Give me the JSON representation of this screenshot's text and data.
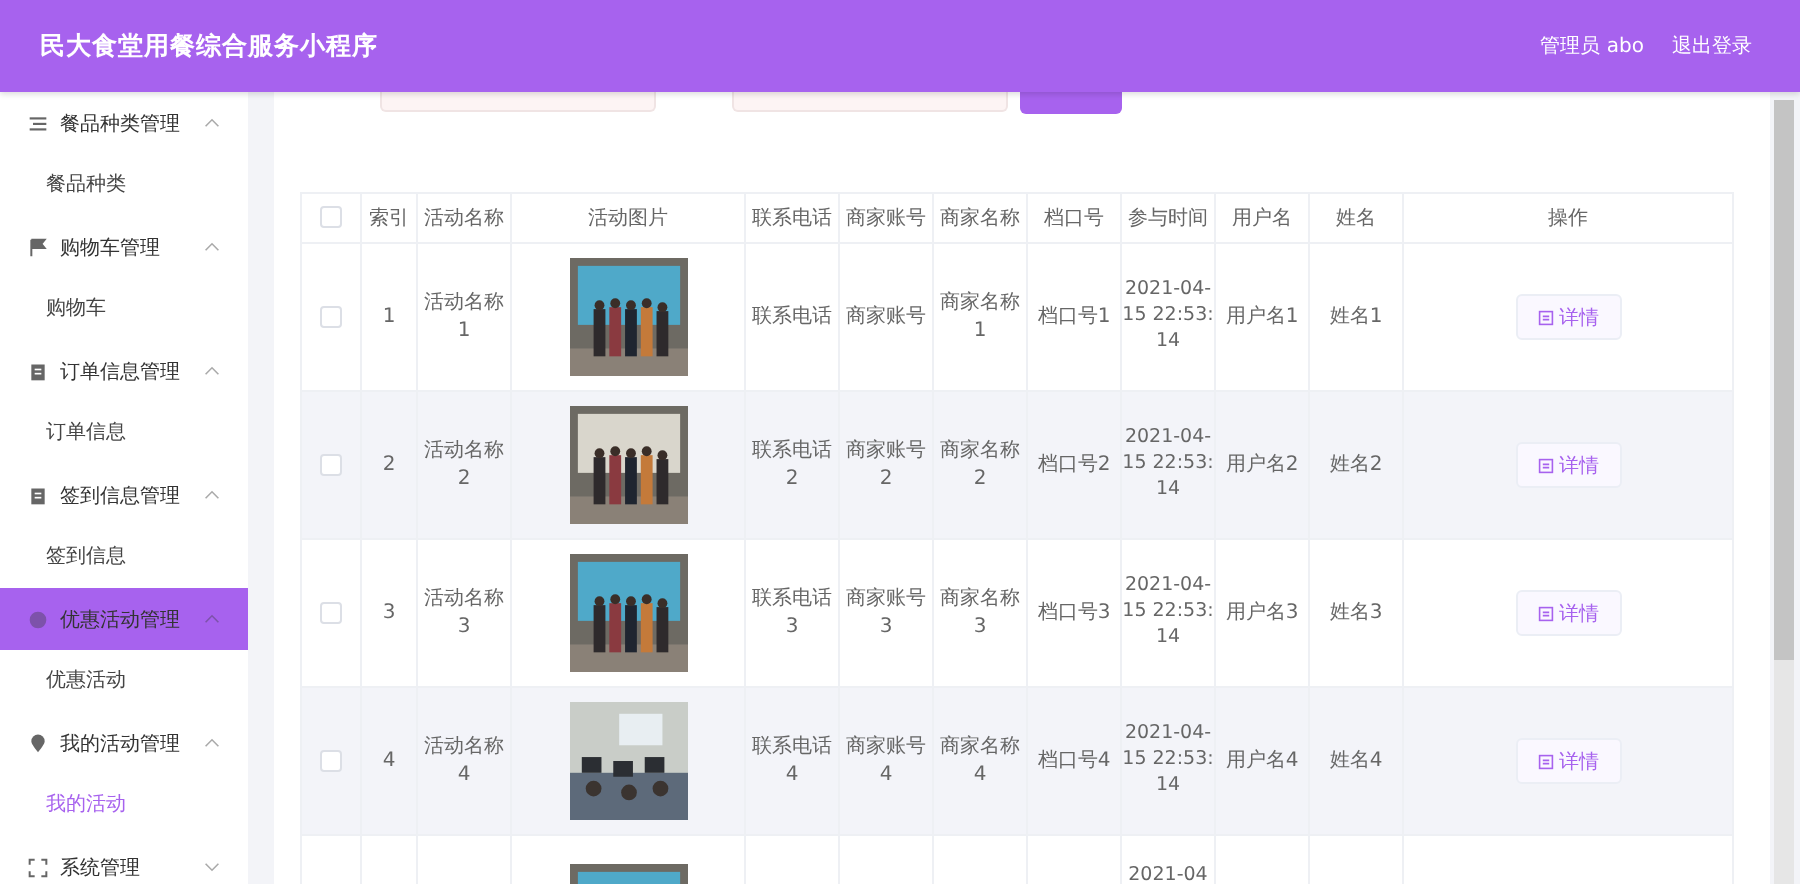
{
  "header": {
    "title": "民大食堂用餐综合服务小程序",
    "user": "管理员 abo",
    "logout": "退出登录"
  },
  "sidebar": {
    "menus": [
      {
        "label": "餐品种类管理",
        "expanded": true,
        "selected": false,
        "children": [
          {
            "label": "餐品种类",
            "selected": false
          }
        ]
      },
      {
        "label": "购物车管理",
        "expanded": true,
        "selected": false,
        "children": [
          {
            "label": "购物车",
            "selected": false
          }
        ]
      },
      {
        "label": "订单信息管理",
        "expanded": true,
        "selected": false,
        "children": [
          {
            "label": "订单信息",
            "selected": false
          }
        ]
      },
      {
        "label": "签到信息管理",
        "expanded": true,
        "selected": false,
        "children": [
          {
            "label": "签到信息",
            "selected": false
          }
        ]
      },
      {
        "label": "优惠活动管理",
        "expanded": true,
        "selected": true,
        "children": [
          {
            "label": "优惠活动",
            "selected": false
          }
        ]
      },
      {
        "label": "我的活动管理",
        "expanded": true,
        "selected": false,
        "children": [
          {
            "label": "我的活动",
            "selected": true
          }
        ]
      },
      {
        "label": "系统管理",
        "expanded": false,
        "selected": false
      }
    ]
  },
  "table": {
    "all_checked": false,
    "columns": [
      "索引",
      "活动名称",
      "活动图片",
      "联系电话",
      "商家账号",
      "商家名称",
      "档口号",
      "参与时间",
      "用户名",
      "姓名",
      "操作"
    ],
    "rows": [
      {
        "checked": false,
        "index": "1",
        "name": "活动名称1",
        "phone": "联系电话",
        "account": "商家账号",
        "merchant": "商家名称1",
        "stall": "档口号1",
        "time": "2021-04-15 22:53:14",
        "user": "用户名1",
        "realname": "姓名1",
        "action": "详情"
      },
      {
        "checked": false,
        "index": "2",
        "name": "活动名称2",
        "phone": "联系电话2",
        "account": "商家账号2",
        "merchant": "商家名称2",
        "stall": "档口号2",
        "time": "2021-04-15 22:53:14",
        "user": "用户名2",
        "realname": "姓名2",
        "action": "详情"
      },
      {
        "checked": false,
        "index": "3",
        "name": "活动名称3",
        "phone": "联系电话3",
        "account": "商家账号3",
        "merchant": "商家名称3",
        "stall": "档口号3",
        "time": "2021-04-15 22:53:14",
        "user": "用户名3",
        "realname": "姓名3",
        "action": "详情"
      },
      {
        "checked": false,
        "index": "4",
        "name": "活动名称4",
        "phone": "联系电话4",
        "account": "商家账号4",
        "merchant": "商家名称4",
        "stall": "档口号4",
        "time": "2021-04-15 22:53:14",
        "user": "用户名4",
        "realname": "姓名4",
        "action": "详情"
      },
      {
        "time": "2021-04"
      }
    ]
  }
}
